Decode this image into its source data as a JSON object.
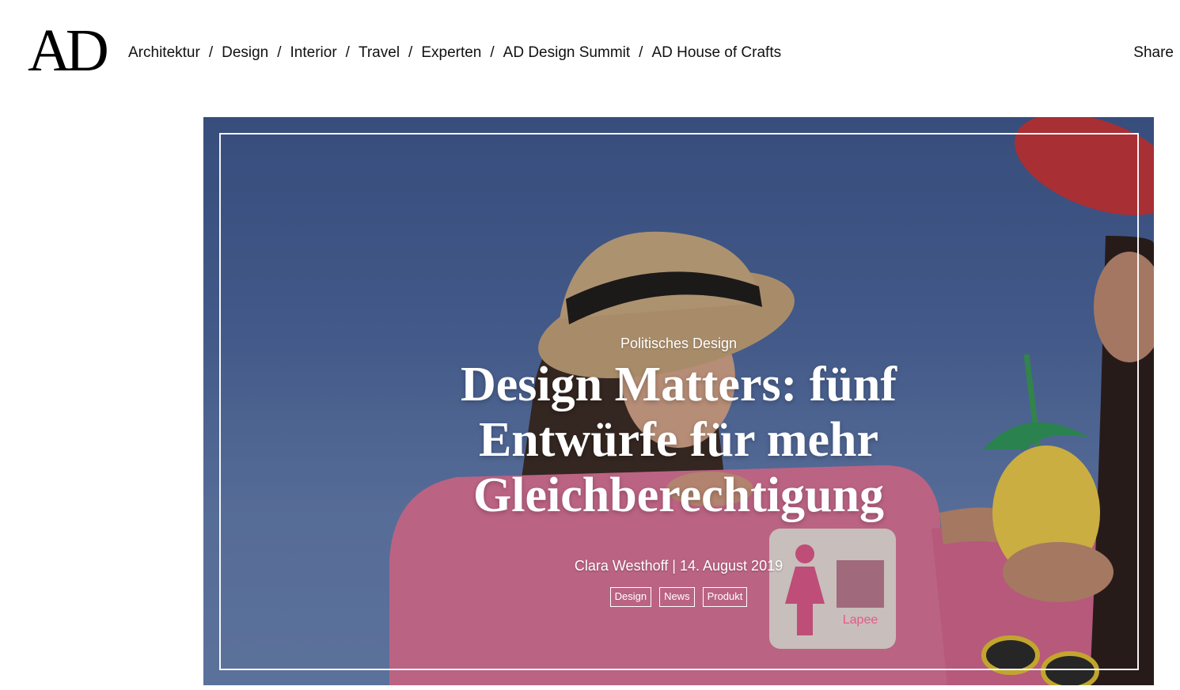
{
  "header": {
    "logo": "AD",
    "nav": [
      {
        "label": "Architektur"
      },
      {
        "label": "Design"
      },
      {
        "label": "Interior"
      },
      {
        "label": "Travel"
      },
      {
        "label": "Experten"
      },
      {
        "label": "AD Design Summit"
      },
      {
        "label": "AD House of Crafts"
      }
    ],
    "separator": "/",
    "share_label": "Share"
  },
  "hero": {
    "category": "Politisches Design",
    "title": "Design Matters: fünf Entwürfe für mehr Gleichberechtigung",
    "author": "Clara Westhoff",
    "byline_divider": "|",
    "date": "14. August 2019",
    "tags": [
      "Design",
      "News",
      "Produkt"
    ],
    "image_sign_text": "Lapee",
    "colors": {
      "sky": "#4b67a0",
      "seat_pink": "#e0749a",
      "hat_red": "#c8353a",
      "straw_hat": "#c9a77a",
      "pineapple_yellow": "#f2d04a",
      "pineapple_leaves": "#2f9a5a"
    }
  }
}
